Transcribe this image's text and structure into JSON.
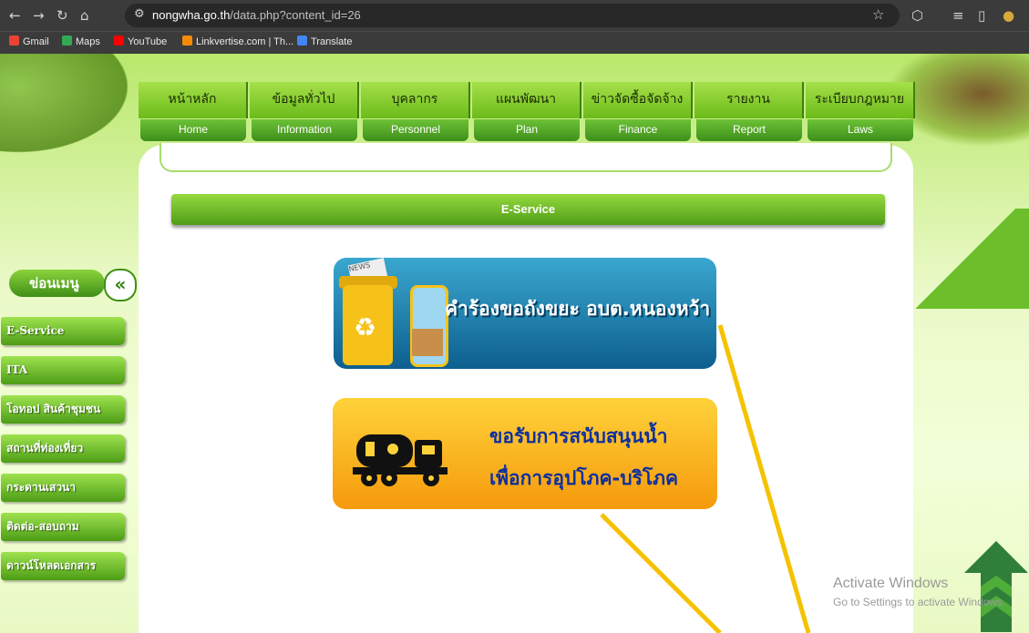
{
  "browser": {
    "url_host": "nongwha.go.th",
    "url_path": "/data.php?content_id=26",
    "bookmarks": [
      {
        "label": "Gmail",
        "color": "#ea4335"
      },
      {
        "label": "Maps",
        "color": "#34a853"
      },
      {
        "label": "YouTube",
        "color": "#ff0000"
      },
      {
        "label": "Linkvertise.com | Th...",
        "color": "#f58a07"
      },
      {
        "label": "Translate",
        "color": "#4285f4"
      }
    ]
  },
  "nav": {
    "items": [
      {
        "th": "หน้าหลัก",
        "en": "Home"
      },
      {
        "th": "ข้อมูลทั่วไป",
        "en": "Information"
      },
      {
        "th": "บุคลากร",
        "en": "Personnel"
      },
      {
        "th": "แผนพัฒนา",
        "en": "Plan"
      },
      {
        "th": "ข่าวจัดซื้อจัดจ้าง",
        "en": "Finance"
      },
      {
        "th": "รายงาน",
        "en": "Report"
      },
      {
        "th": "ระเบียบกฎหมาย",
        "en": "Laws"
      }
    ]
  },
  "section": {
    "title": "E-Service"
  },
  "sidebar": {
    "title": "ข่อนเมนู",
    "toggle_symbol": "«",
    "items": [
      {
        "label": "E-Service"
      },
      {
        "label": "ITA"
      },
      {
        "label": "โอทอป สินค้าชุมชน"
      },
      {
        "label": "สถานที่ท่องเที่ยว"
      },
      {
        "label": "กระดานเสวนา"
      },
      {
        "label": "ติดต่อ-สอบถาม"
      },
      {
        "label": "ดาวน์โหลดเอกสาร"
      }
    ]
  },
  "banners": {
    "garbage": {
      "text": "คำร้องขอถังขยะ อบต.หนองหว้า",
      "news_label": "NEWS"
    },
    "water": {
      "line1": "ขอรับการสนับสนุนน้ำ",
      "line2": "เพื่อการอุปโภค-บริโภค"
    }
  },
  "watermark": {
    "line1": "Activate Windows",
    "line2": "Go to Settings to activate Windows."
  },
  "colors": {
    "nav_green": "#6bbb19",
    "annotation_arrow": "#f6c200",
    "banner_blue": "#0d5f8f",
    "banner_orange": "#f59a0c"
  }
}
